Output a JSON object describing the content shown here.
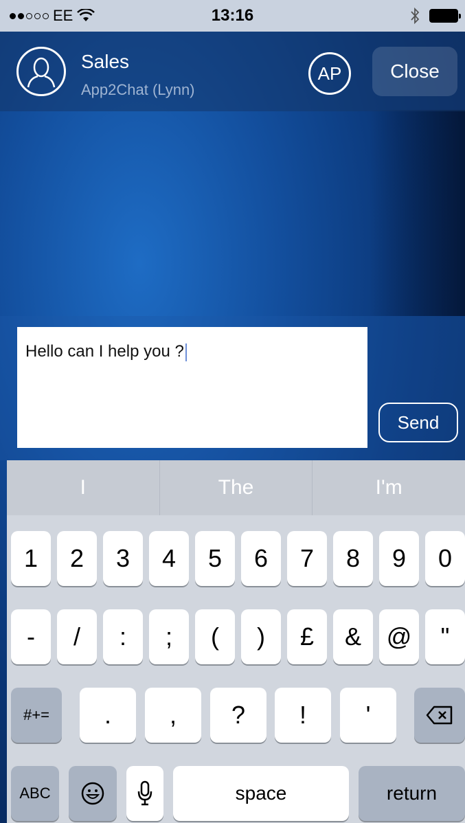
{
  "status_bar": {
    "carrier": "EE",
    "time": "13:16"
  },
  "header": {
    "title": "Sales",
    "subtitle": "App2Chat (Lynn)",
    "agent_initials": "AP",
    "close_label": "Close"
  },
  "composer": {
    "message": "Hello can I help you ?",
    "send_label": "Send"
  },
  "keyboard": {
    "suggestions": [
      "I",
      "The",
      "I'm"
    ],
    "row1": [
      "1",
      "2",
      "3",
      "4",
      "5",
      "6",
      "7",
      "8",
      "9",
      "0"
    ],
    "row2": [
      "-",
      "/",
      ":",
      ";",
      "(",
      ")",
      "£",
      "&",
      "@",
      "\""
    ],
    "row3": [
      ".",
      ",",
      "?",
      "!",
      "'"
    ],
    "symbols_label": "#+=",
    "abc_label": "ABC",
    "space_label": "space",
    "return_label": "return"
  },
  "icons": [
    "user-silhouette-icon",
    "wifi-icon",
    "bluetooth-icon",
    "battery-icon",
    "backspace-icon",
    "emoji-icon",
    "microphone-icon"
  ]
}
